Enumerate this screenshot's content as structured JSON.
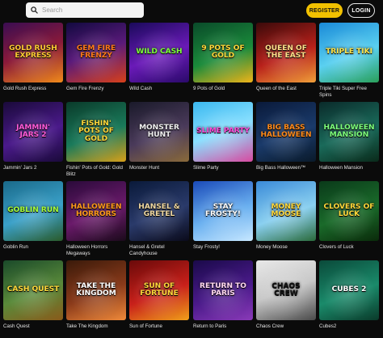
{
  "header": {
    "search_placeholder": "Search",
    "register_label": "REGISTER",
    "login_label": "LOGIN"
  },
  "colors": {
    "accent": "#f2c100",
    "background": "#0b0b0b"
  },
  "games": [
    {
      "caption": "Gold Rush Express",
      "art": "GOLD RUSH EXPRESS",
      "bg": "linear-gradient(160deg,#3a0d52,#8a1a3a 50%,#f08a1a)",
      "fg": "#ffcc33"
    },
    {
      "caption": "Gem Fire Frenzy",
      "art": "GEM FIRE FRENZY",
      "bg": "linear-gradient(160deg,#120a40,#5a1a7a 50%,#d8401a)",
      "fg": "#ff7a1a"
    },
    {
      "caption": "Wild Cash",
      "art": "WILD CASH",
      "bg": "linear-gradient(160deg,#1a0a5a,#6a1ab8 55%,#2a0a6a)",
      "fg": "#7dff3a"
    },
    {
      "caption": "9 Pots of Gold",
      "art": "9 POTS OF GOLD",
      "bg": "linear-gradient(160deg,#0a4a2a,#1a8a3a 55%,#f0b41a)",
      "fg": "#ffd93a"
    },
    {
      "caption": "Queen of the East",
      "art": "QUEEN OF THE EAST",
      "bg": "linear-gradient(160deg,#3a0a0a,#b8201a 55%,#f0a03a)",
      "fg": "#ffe08a"
    },
    {
      "caption": "Triple Tiki Super Free Spins",
      "art": "TRIPLE TIKI",
      "bg": "linear-gradient(160deg,#1a8ad8,#5ad0f0 55%,#2aa05a)",
      "fg": "#ffe44a"
    },
    {
      "caption": "Jammin' Jars 2",
      "art": "JAMMIN' JARS 2",
      "bg": "linear-gradient(160deg,#1a0a3a,#4a1a8a 55%,#1a0a3a)",
      "fg": "#ff5ad8"
    },
    {
      "caption": "Fishin' Pots of Gold: Gold Blitz",
      "art": "FISHIN' POTS OF GOLD",
      "bg": "linear-gradient(160deg,#0a3a2a,#1a7a5a 55%,#d8a01a)",
      "fg": "#ffd83a"
    },
    {
      "caption": "Monster Hunt",
      "art": "MONSTER HUNT",
      "bg": "linear-gradient(160deg,#1a1a2a,#4a3a5a 55%,#8a6a3a)",
      "fg": "#f0f0f0"
    },
    {
      "caption": "Slime Party",
      "art": "SLIME PARTY",
      "bg": "linear-gradient(160deg,#3ab8f0,#8ae0ff 50%,#d84aa0)",
      "fg": "#ff4ad8"
    },
    {
      "caption": "Big Bass Halloween™",
      "art": "BIG BASS HALLOWEEN",
      "bg": "linear-gradient(160deg,#0a1a3a,#1a3a6a 55%,#0a1a2a)",
      "fg": "#ff8a1a"
    },
    {
      "caption": "Halloween Mansion",
      "art": "HALLOWEEN MANSION",
      "bg": "linear-gradient(160deg,#0a2a2a,#1a6a5a 55%,#0a2a1a)",
      "fg": "#7dff7a"
    },
    {
      "caption": "Goblin Run",
      "art": "GOBLIN RUN",
      "bg": "linear-gradient(160deg,#1a6a8a,#3aa0c8 55%,#2a5a2a)",
      "fg": "#a8ff3a"
    },
    {
      "caption": "Halloween Horrors Megaways",
      "art": "HALLOWEEN HORRORS",
      "bg": "linear-gradient(160deg,#2a0a3a,#6a1a6a 55%,#1a0a1a)",
      "fg": "#ff9a1a"
    },
    {
      "caption": "Hansel & Gretel Candyhouse",
      "art": "HANSEL & GRETEL",
      "bg": "linear-gradient(160deg,#0a1a3a,#2a3a6a 55%,#0a0a1a)",
      "fg": "#f0d8a0"
    },
    {
      "caption": "Stay Frosty!",
      "art": "STAY FROSTY!",
      "bg": "linear-gradient(160deg,#1a4ab8,#6ab0f0 55%,#c8e8ff)",
      "fg": "#ffffff"
    },
    {
      "caption": "Money Moose",
      "art": "MONEY MOOSE",
      "bg": "linear-gradient(160deg,#3a8ad8,#8ad0f0 55%,#2a6a3a)",
      "fg": "#ffd83a"
    },
    {
      "caption": "Clovers of Luck",
      "art": "CLOVERS OF LUCK",
      "bg": "linear-gradient(160deg,#0a3a1a,#1a6a2a 55%,#0a2a0a)",
      "fg": "#ffd83a"
    },
    {
      "caption": "Cash Quest",
      "art": "CASH QUEST",
      "bg": "linear-gradient(160deg,#1a4a2a,#5a8a3a 55%,#8a5a1a)",
      "fg": "#ffd83a"
    },
    {
      "caption": "Take The Kingdom",
      "art": "TAKE THE KINGDOM",
      "bg": "linear-gradient(160deg,#3a1a0a,#8a3a1a 55%,#f08a3a)",
      "fg": "#ffffff"
    },
    {
      "caption": "Sun of Fortune",
      "art": "SUN OF FORTUNE",
      "bg": "linear-gradient(160deg,#6a0a0a,#c8201a 55%,#f0a01a)",
      "fg": "#ffd83a"
    },
    {
      "caption": "Return to Paris",
      "art": "RETURN TO PARIS",
      "bg": "linear-gradient(160deg,#1a0a4a,#4a1a8a 55%,#8a3ab8)",
      "fg": "#ffd8f0"
    },
    {
      "caption": "Chaos Crew",
      "art": "CHAOS CREW",
      "bg": "linear-gradient(160deg,#e8e8e8,#c8c8c8 50%,#4a4a4a)",
      "fg": "#111111"
    },
    {
      "caption": "Cubes2",
      "art": "CUBES 2",
      "bg": "linear-gradient(160deg,#0a4a3a,#1a8a6a 55%,#0a3a2a)",
      "fg": "#ffffff"
    }
  ]
}
